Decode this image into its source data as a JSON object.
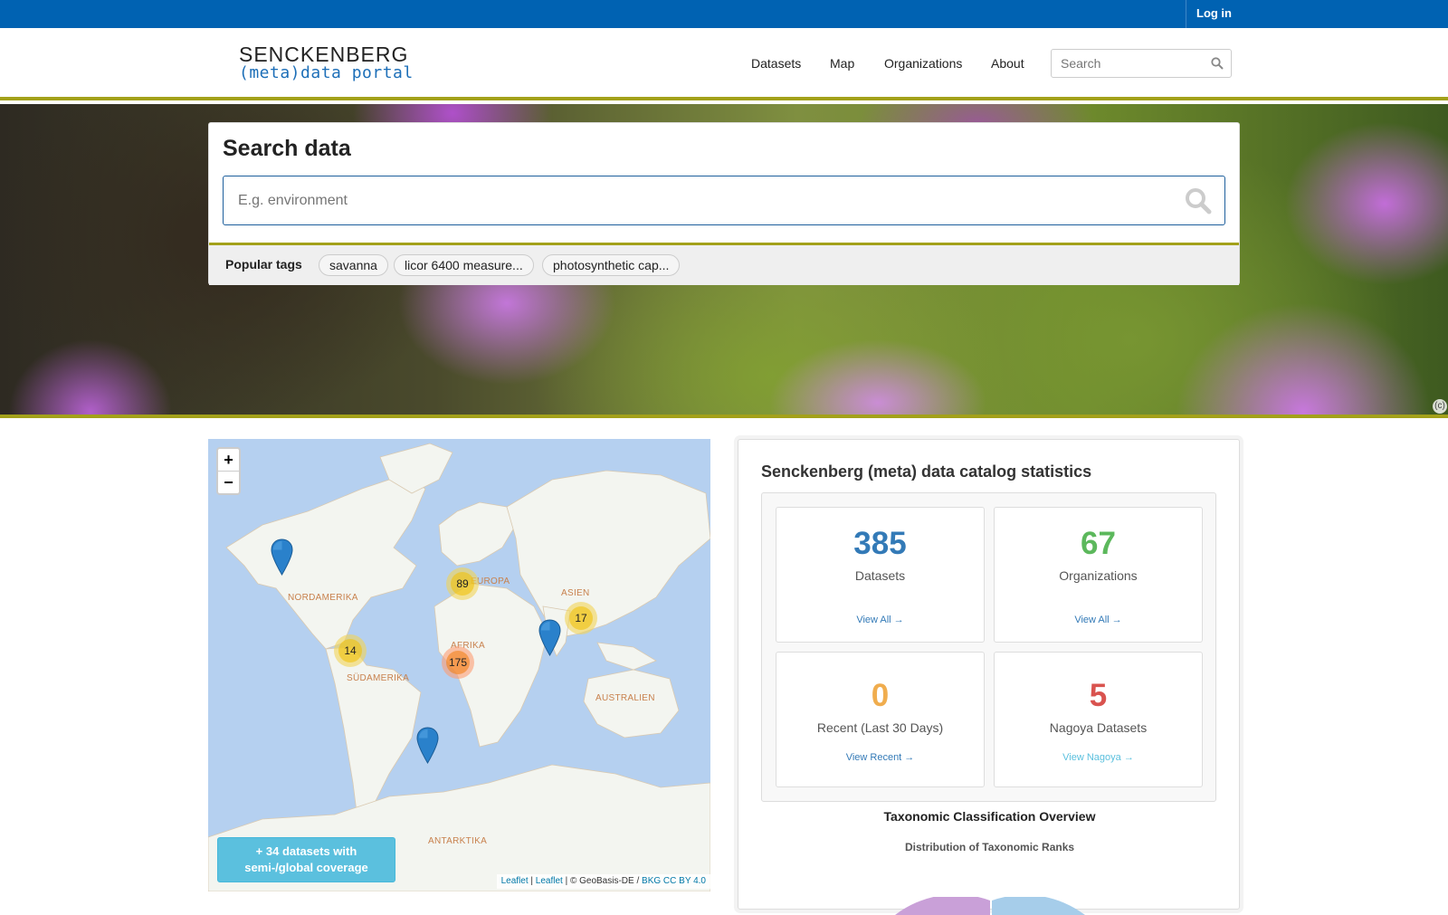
{
  "topbar": {
    "login_label": "Log in"
  },
  "header": {
    "logo_line1": "SENCKENBERG",
    "logo_line2": "(meta)data portal",
    "nav": [
      "Datasets",
      "Map",
      "Organizations",
      "About"
    ],
    "search_placeholder": "Search"
  },
  "hero": {
    "title": "Search data",
    "search_placeholder": "E.g. environment",
    "popular_tags_label": "Popular tags",
    "tags": [
      "savanna",
      "licor 6400 measure...",
      "photosynthetic cap..."
    ],
    "copyright_mark": "(c)"
  },
  "map": {
    "zoom_in": "+",
    "zoom_out": "−",
    "clusters": [
      "89",
      "17",
      "14",
      "175"
    ],
    "labels": [
      "NORDAMERIKA",
      "SÜDAMERIKA",
      "EUROPA",
      "ASIEN",
      "AFRIKA",
      "AUSTRALIEN",
      "ANTARKTIKA"
    ],
    "coverage_line1": "+ 34 datasets with",
    "coverage_line2": "semi-/global coverage",
    "attribution": {
      "leaflet1": "Leaflet",
      "sep1": " | ",
      "leaflet2": "Leaflet",
      "sep2": " | © GeoBasis-DE / ",
      "bkg": "BKG CC BY 4.0"
    }
  },
  "stats": {
    "title": "Senckenberg (meta) data catalog statistics",
    "cards": [
      {
        "value": "385",
        "label": "Datasets",
        "link": "View All →",
        "color": "#337ab7"
      },
      {
        "value": "67",
        "label": "Organizations",
        "link": "View All →",
        "color": "#5cb85c"
      },
      {
        "value": "0",
        "label": "Recent (Last 30 Days)",
        "link": "View Recent →",
        "color": "#f0ad4e"
      },
      {
        "value": "5",
        "label": "Nagoya Datasets",
        "link": "View Nagoya →",
        "color": "#d9534f"
      }
    ],
    "taxonomy_title": "Taxonomic Classification Overview",
    "taxonomy_subtitle": "Distribution of Taxonomic Ranks"
  },
  "colors": {
    "brand_blue": "#0062b2",
    "olive_rule": "#a3a11a",
    "link_blue": "#337ab7",
    "nagoya_link": "#5bc0de"
  }
}
